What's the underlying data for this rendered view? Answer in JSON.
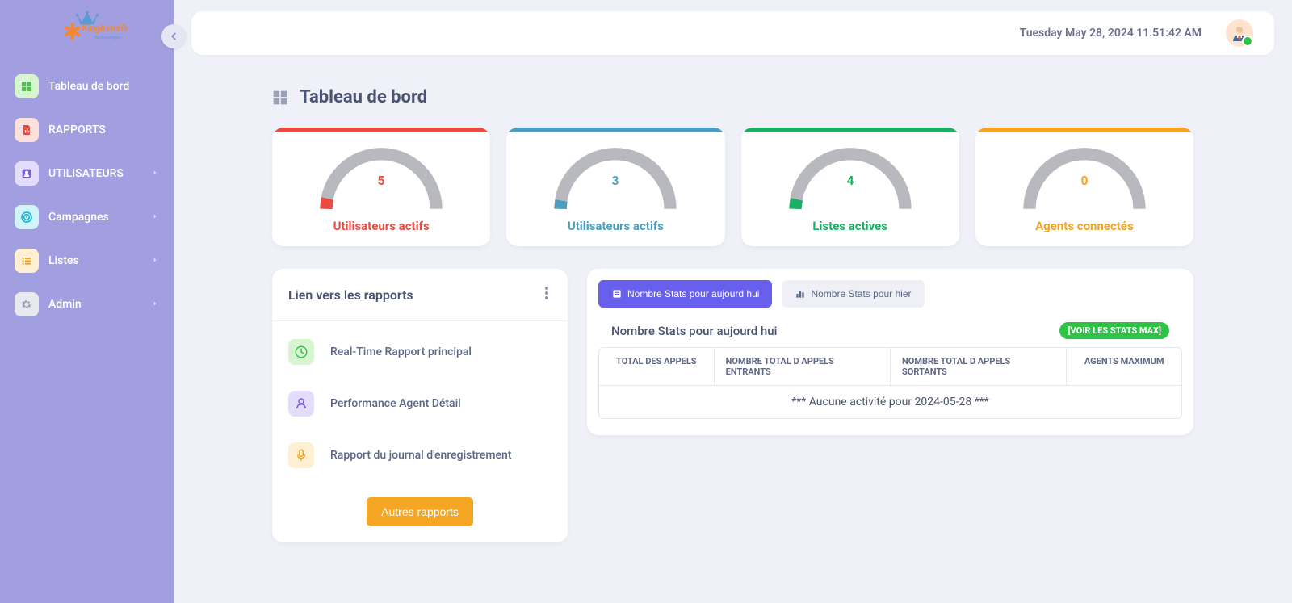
{
  "header": {
    "timestamp": "Tuesday May 28, 2024 11:51:42 AM"
  },
  "sidebar": {
    "brand_main": "KingAsterisk",
    "brand_sub": "Technologies",
    "items": [
      {
        "label": "Tableau de bord",
        "has_chevron": false
      },
      {
        "label": "RAPPORTS",
        "has_chevron": false
      },
      {
        "label": "UTILISATEURS",
        "has_chevron": true
      },
      {
        "label": "Campagnes",
        "has_chevron": true
      },
      {
        "label": "Listes",
        "has_chevron": true
      },
      {
        "label": "Admin",
        "has_chevron": true
      }
    ]
  },
  "page": {
    "title": "Tableau de bord"
  },
  "gauges": [
    {
      "value": "5",
      "label": "Utilisateurs actifs",
      "color": "red"
    },
    {
      "value": "3",
      "label": "Utilisateurs actifs",
      "color": "blue"
    },
    {
      "value": "4",
      "label": "Listes actives",
      "color": "green"
    },
    {
      "value": "0",
      "label": "Agents connectés",
      "color": "orange"
    }
  ],
  "report_links": {
    "title": "Lien vers les rapports",
    "items": [
      {
        "label": "Real-Time Rapport principal"
      },
      {
        "label": "Performance Agent Détail"
      },
      {
        "label": "Rapport du journal d'enregistrement"
      }
    ],
    "button": "Autres rapports"
  },
  "stats": {
    "tabs": [
      {
        "label": "Nombre Stats pour aujourd hui",
        "active": true
      },
      {
        "label": "Nombre Stats pour hier",
        "active": false
      }
    ],
    "section_title": "Nombre Stats pour aujourd hui",
    "pill": "[VOIR LES STATS MAX]",
    "columns": [
      "TOTAL DES APPELS",
      "NOMBRE TOTAL D APPELS ENTRANTS",
      "NOMBRE TOTAL D APPELS SORTANTS",
      "AGENTS MAXIMUM"
    ],
    "empty_row": "*** Aucune activité pour 2024-05-28 ***"
  },
  "chart_data": [
    {
      "type": "gauge",
      "title": "Utilisateurs actifs",
      "value": 5,
      "range": [
        0,
        100
      ],
      "color": "#eb4a3f"
    },
    {
      "type": "gauge",
      "title": "Utilisateurs actifs",
      "value": 3,
      "range": [
        0,
        100
      ],
      "color": "#4c9ec1"
    },
    {
      "type": "gauge",
      "title": "Listes actives",
      "value": 4,
      "range": [
        0,
        100
      ],
      "color": "#1aaf63"
    },
    {
      "type": "gauge",
      "title": "Agents connectés",
      "value": 0,
      "range": [
        0,
        100
      ],
      "color": "#f2a423"
    }
  ]
}
